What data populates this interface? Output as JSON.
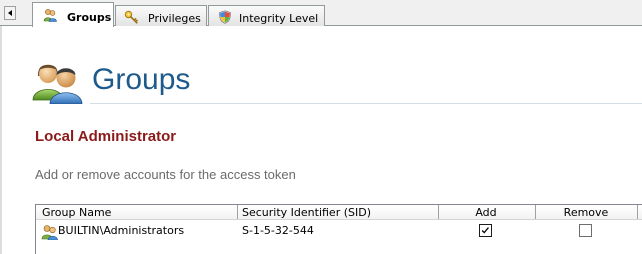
{
  "tabs": [
    {
      "label": "Groups",
      "icon": "users-icon",
      "active": true
    },
    {
      "label": "Privileges",
      "icon": "key-icon",
      "active": false
    },
    {
      "label": "Integrity Level",
      "icon": "shield-icon",
      "active": false
    }
  ],
  "header": {
    "title": "Groups",
    "icon": "users-icon"
  },
  "section": {
    "title": "Local Administrator",
    "description": "Add or remove accounts for the access token"
  },
  "table": {
    "columns": [
      "Group Name",
      "Security Identifier (SID)",
      "Add",
      "Remove"
    ],
    "rows": [
      {
        "group_name": "BUILTIN\\Administrators",
        "sid": "S-1-5-32-544",
        "add": true,
        "remove": false,
        "icon": "group-icon"
      }
    ]
  },
  "colors": {
    "title": "#1e5a8c",
    "section_title": "#8b1a1a",
    "description": "#6b6b6b"
  }
}
